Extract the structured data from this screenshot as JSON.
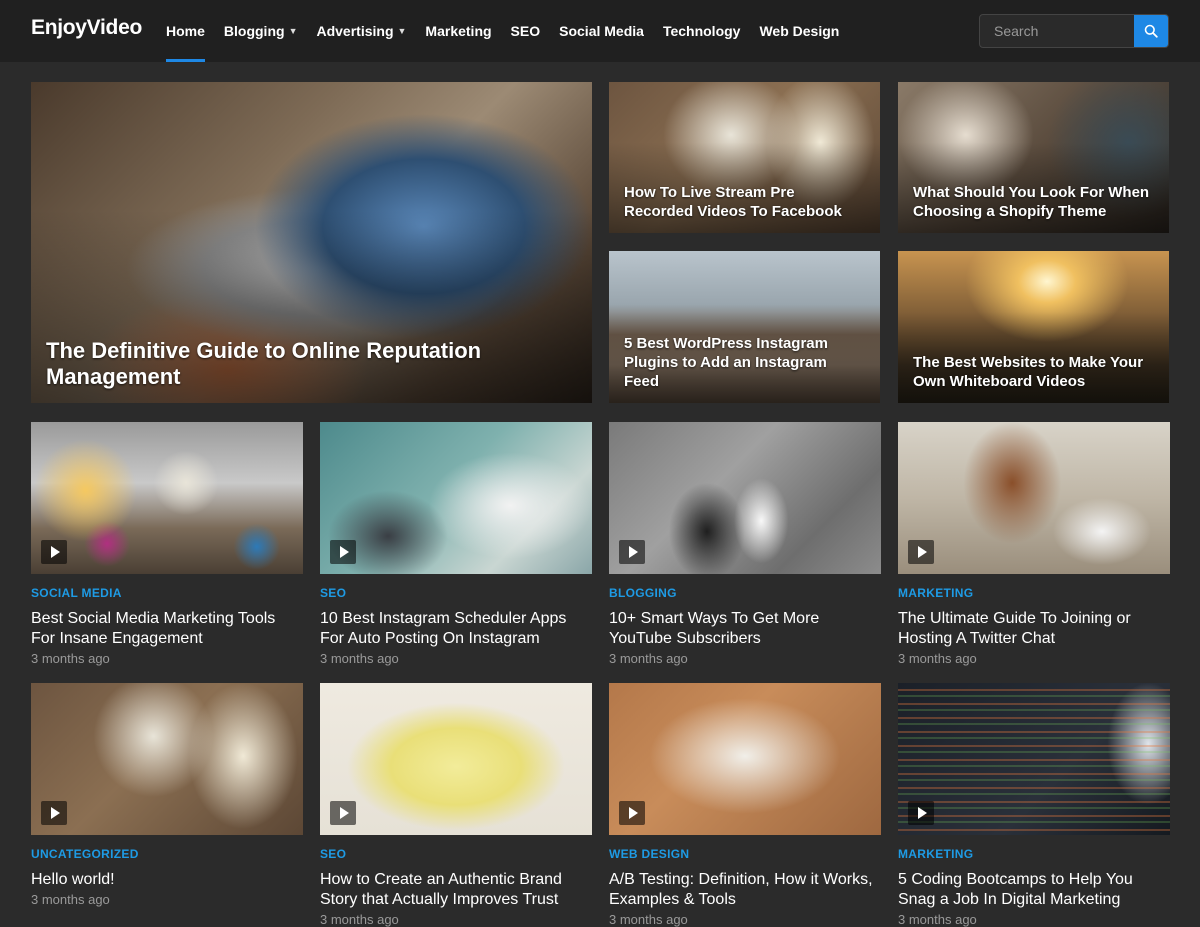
{
  "header": {
    "logo": "EnjoyVideo",
    "nav": [
      {
        "label": "Home",
        "active": true,
        "dropdown": false
      },
      {
        "label": "Blogging",
        "active": false,
        "dropdown": true
      },
      {
        "label": "Advertising",
        "active": false,
        "dropdown": true
      },
      {
        "label": "Marketing",
        "active": false,
        "dropdown": false
      },
      {
        "label": "SEO",
        "active": false,
        "dropdown": false
      },
      {
        "label": "Social Media",
        "active": false,
        "dropdown": false
      },
      {
        "label": "Technology",
        "active": false,
        "dropdown": false
      },
      {
        "label": "Web Design",
        "active": false,
        "dropdown": false
      }
    ],
    "search": {
      "placeholder": "Search",
      "icon": "search-icon"
    }
  },
  "featured": [
    {
      "title": "The Definitive Guide to Online Reputation Management",
      "image": "laptop-on-desk"
    },
    {
      "title": "How To Live Stream Pre Recorded Videos To Facebook",
      "image": "phone-and-notebook"
    },
    {
      "title": "What Should You Look For When Choosing a Shopify Theme",
      "image": "woman-with-phone"
    },
    {
      "title": "5 Best WordPress Instagram Plugins to Add an Instagram Feed",
      "image": "bridge-runners"
    },
    {
      "title": "The Best Websites to Make Your Own Whiteboard Videos",
      "image": "sunset-portrait"
    }
  ],
  "posts": [
    {
      "category": "SOCIAL MEDIA",
      "title": "Best Social Media Marketing Tools For Insane Engagement",
      "date": "3 months ago"
    },
    {
      "category": "SEO",
      "title": "10 Best Instagram Scheduler Apps For Auto Posting On Instagram",
      "date": "3 months ago"
    },
    {
      "category": "BLOGGING",
      "title": "10+ Smart Ways To Get More YouTube Subscribers",
      "date": "3 months ago"
    },
    {
      "category": "MARKETING",
      "title": "The Ultimate Guide To Joining or Hosting A Twitter Chat",
      "date": "3 months ago"
    },
    {
      "category": "UNCATEGORIZED",
      "title": "Hello world!",
      "date": "3 months ago"
    },
    {
      "category": "SEO",
      "title": "How to Create an Authentic Brand Story that Actually Improves Trust",
      "date": "3 months ago"
    },
    {
      "category": "WEB DESIGN",
      "title": "A/B Testing: Definition, How it Works, Examples & Tools",
      "date": "3 months ago"
    },
    {
      "category": "MARKETING",
      "title": "5 Coding Bootcamps to Help You Snag a Job In Digital Marketing",
      "date": "3 months ago"
    }
  ],
  "colors": {
    "accent": "#1e88e5",
    "category": "#1e9be5",
    "background": "#2b2b2b",
    "header": "#202020"
  }
}
